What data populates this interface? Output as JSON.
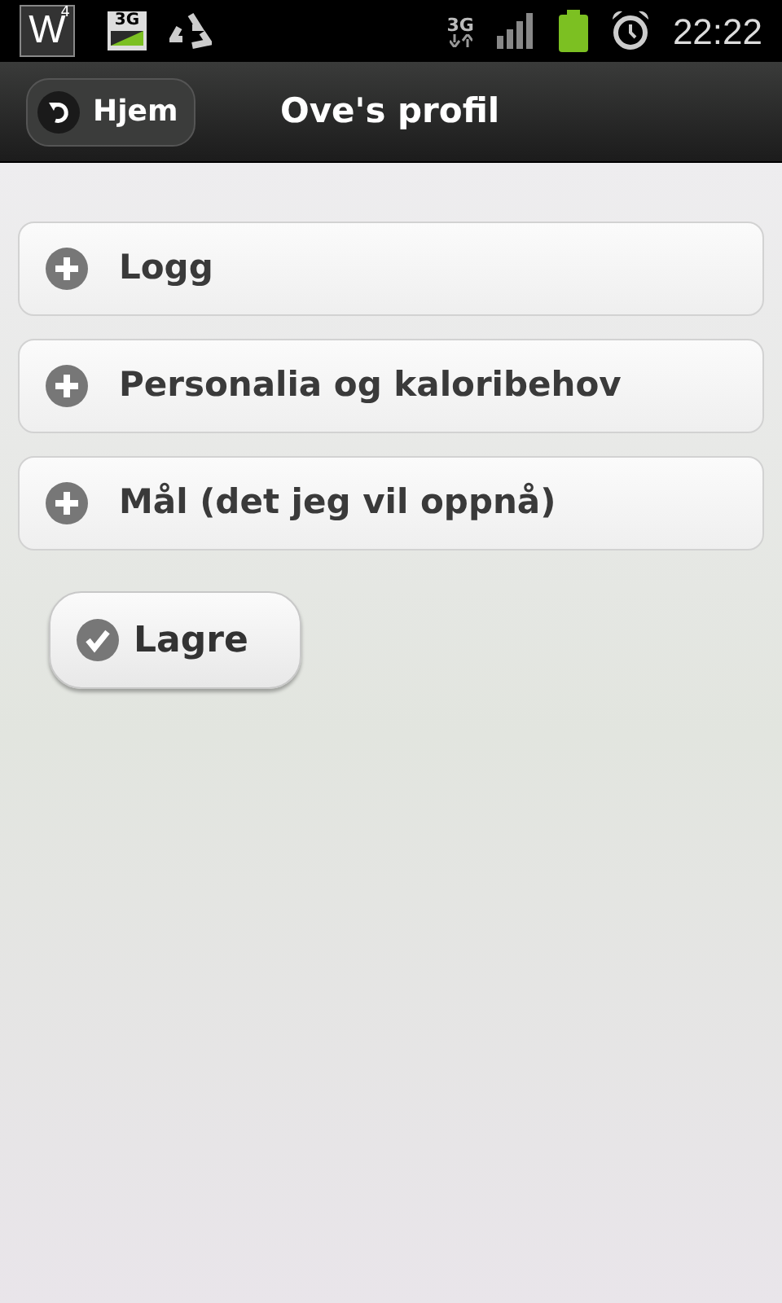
{
  "status_bar": {
    "app_icon_letter": "W",
    "app_icon_badge": "4",
    "notification_badge": "3G",
    "network_type": "3G",
    "time": "22:22"
  },
  "header": {
    "back_button": "Hjem",
    "title": "Ove's profil"
  },
  "sections": [
    {
      "label": "Logg",
      "expanded": false
    },
    {
      "label": "Personalia og kaloribehov",
      "expanded": false
    },
    {
      "label": "Mål (det jeg vil oppnå)",
      "expanded": false
    }
  ],
  "save_button": "Lagre"
}
